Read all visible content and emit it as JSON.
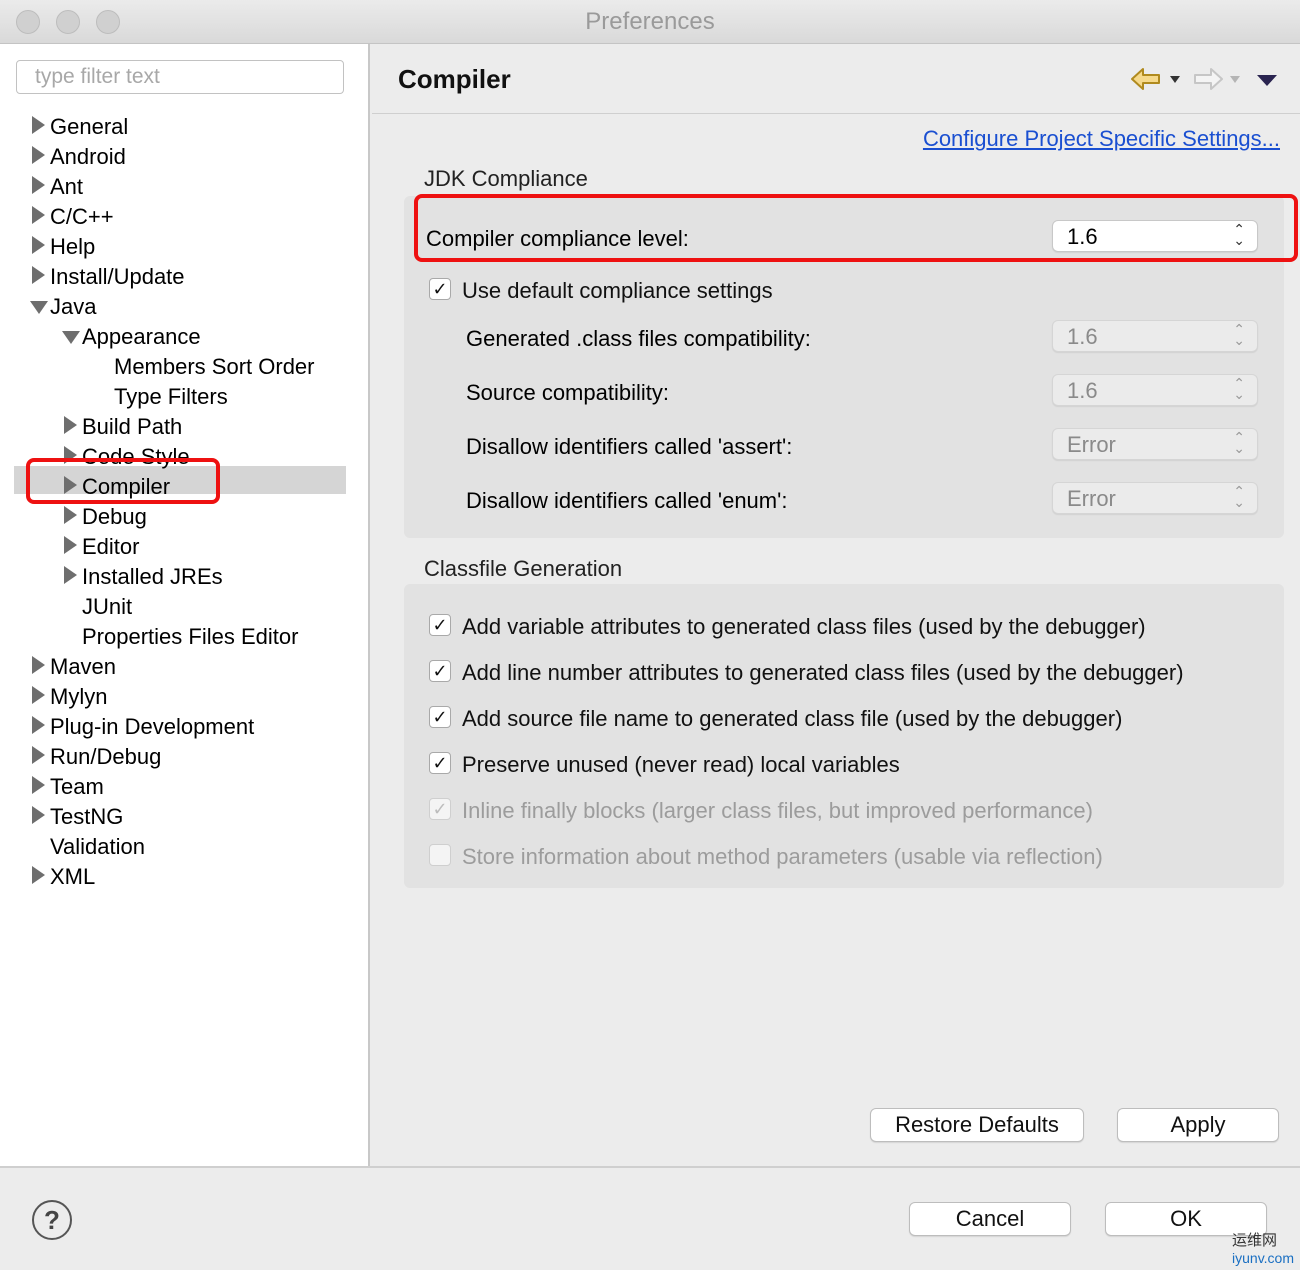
{
  "window": {
    "title": "Preferences"
  },
  "sidebar": {
    "filter_placeholder": "type filter text",
    "items": [
      {
        "label": "General",
        "expander": "collapsed",
        "level": 0
      },
      {
        "label": "Android",
        "expander": "collapsed",
        "level": 0
      },
      {
        "label": "Ant",
        "expander": "collapsed",
        "level": 0
      },
      {
        "label": "C/C++",
        "expander": "collapsed",
        "level": 0
      },
      {
        "label": "Help",
        "expander": "collapsed",
        "level": 0
      },
      {
        "label": "Install/Update",
        "expander": "collapsed",
        "level": 0
      },
      {
        "label": "Java",
        "expander": "expanded",
        "level": 0
      },
      {
        "label": "Appearance",
        "expander": "expanded",
        "level": 1
      },
      {
        "label": "Members Sort Order",
        "expander": "none",
        "level": 2
      },
      {
        "label": "Type Filters",
        "expander": "none",
        "level": 2
      },
      {
        "label": "Build Path",
        "expander": "collapsed",
        "level": 1
      },
      {
        "label": "Code Style",
        "expander": "collapsed",
        "level": 1
      },
      {
        "label": "Compiler",
        "expander": "collapsed",
        "level": 1,
        "selected": true
      },
      {
        "label": "Debug",
        "expander": "collapsed",
        "level": 1
      },
      {
        "label": "Editor",
        "expander": "collapsed",
        "level": 1
      },
      {
        "label": "Installed JREs",
        "expander": "collapsed",
        "level": 1
      },
      {
        "label": "JUnit",
        "expander": "none",
        "level": 1
      },
      {
        "label": "Properties Files Editor",
        "expander": "none",
        "level": 1
      },
      {
        "label": "Maven",
        "expander": "collapsed",
        "level": 0
      },
      {
        "label": "Mylyn",
        "expander": "collapsed",
        "level": 0
      },
      {
        "label": "Plug-in Development",
        "expander": "collapsed",
        "level": 0
      },
      {
        "label": "Run/Debug",
        "expander": "collapsed",
        "level": 0
      },
      {
        "label": "Team",
        "expander": "collapsed",
        "level": 0
      },
      {
        "label": "TestNG",
        "expander": "collapsed",
        "level": 0
      },
      {
        "label": "Validation",
        "expander": "none",
        "level": 0
      },
      {
        "label": "XML",
        "expander": "collapsed",
        "level": 0
      }
    ]
  },
  "header": {
    "title": "Compiler",
    "icons": [
      "back-arrow-icon",
      "forward-arrow-icon",
      "view-menu-icon"
    ]
  },
  "content": {
    "project_link": "Configure Project Specific Settings...",
    "jdk": {
      "group_label": "JDK Compliance",
      "compliance_label": "Compiler compliance level:",
      "compliance_value": "1.6",
      "use_default_label": "Use default compliance settings",
      "use_default_checked": true,
      "rows": [
        {
          "label": "Generated .class files compatibility:",
          "value": "1.6"
        },
        {
          "label": "Source compatibility:",
          "value": "1.6"
        },
        {
          "label": "Disallow identifiers called 'assert':",
          "value": "Error"
        },
        {
          "label": "Disallow identifiers called 'enum':",
          "value": "Error"
        }
      ]
    },
    "classfile": {
      "group_label": "Classfile Generation",
      "options": [
        {
          "label": "Add variable attributes to generated class files (used by the debugger)",
          "checked": true,
          "enabled": true
        },
        {
          "label": "Add line number attributes to generated class files (used by the debugger)",
          "checked": true,
          "enabled": true
        },
        {
          "label": "Add source file name to generated class file (used by the debugger)",
          "checked": true,
          "enabled": true
        },
        {
          "label": "Preserve unused (never read) local variables",
          "checked": true,
          "enabled": true
        },
        {
          "label": "Inline finally blocks (larger class files, but improved performance)",
          "checked": true,
          "enabled": false
        },
        {
          "label": "Store information about method parameters (usable via reflection)",
          "checked": false,
          "enabled": false
        }
      ]
    },
    "restore_defaults_label": "Restore Defaults",
    "apply_label": "Apply"
  },
  "footer": {
    "help_label": "?",
    "cancel_label": "Cancel",
    "ok_label": "OK"
  },
  "watermark": {
    "cn": "运维网",
    "url": "iyunv.com"
  },
  "colors": {
    "highlight": "#ee1111",
    "link": "#1a4fd1",
    "selection": "#d5d5d5"
  }
}
